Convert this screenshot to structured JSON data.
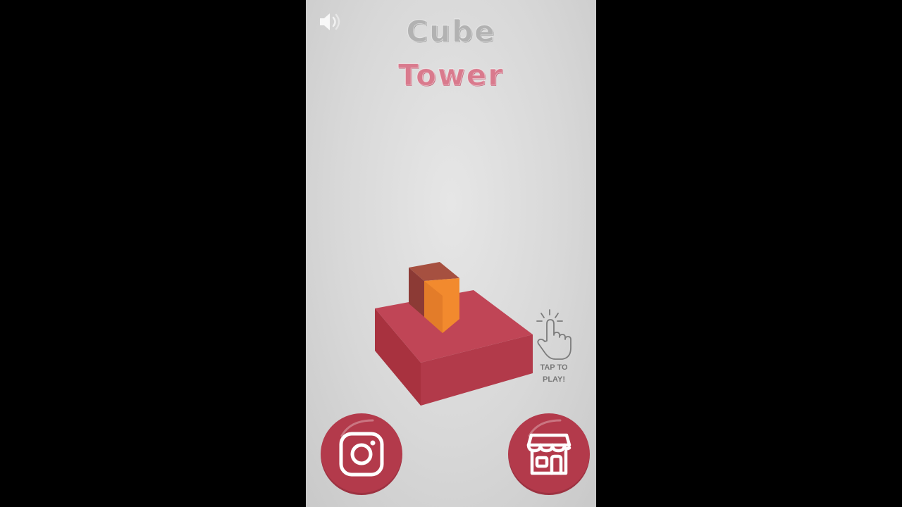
{
  "game": {
    "title_line1": "Cube",
    "title_line2": "Tower",
    "tap_hint_line1": "TAP TO",
    "tap_hint_line2": "PLAY!"
  },
  "icons": {
    "sound": "speaker-icon",
    "tap": "tap-hand-icon",
    "instagram": "instagram-icon",
    "shop": "shop-storefront-icon"
  },
  "colors": {
    "background": "#d9d9d9",
    "title_cube": "#b2b2b2",
    "title_tower": "#d97a8d",
    "base_block": "#b33a4b",
    "top_block": "#f28a2e",
    "button": "#b33a4b"
  }
}
